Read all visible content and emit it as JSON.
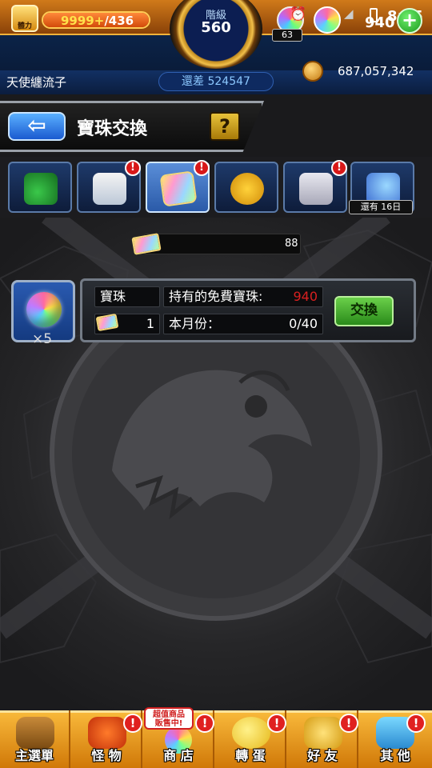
{
  "status_bar": {
    "stamina_icon_label": "體力",
    "stamina_current": "9999+",
    "stamina_max": "/436",
    "stamina_fill": 1.0,
    "rank_label": "階級",
    "rank_value": "560",
    "gem_badge": "63",
    "orb_count": "940",
    "time": "8:25",
    "plus_label": "+"
  },
  "player": {
    "name": "天使纏流子",
    "exp_remaining": "還差 524547",
    "coins": "687,057,342"
  },
  "header": {
    "back_label": "⇦",
    "title": "寶珠交換",
    "help_label": "?"
  },
  "tabs": [
    {
      "name": "lucky-clover",
      "badge": ""
    },
    {
      "name": "gift-items",
      "badge": "!"
    },
    {
      "name": "orb-ticket",
      "badge": "!"
    },
    {
      "name": "monster-gift",
      "badge": ""
    },
    {
      "name": "shop-building",
      "badge": "!"
    },
    {
      "name": "orb-exchange-event",
      "badge": "",
      "days_left": "還有 16日"
    }
  ],
  "ticket": {
    "count": "88"
  },
  "exchange": {
    "orb_multiplier": "×5",
    "orb_label": "寶珠",
    "owned_label": "持有的免費寶珠:",
    "owned_value": "940",
    "ticket_cost": "1",
    "month_label": "本月份：",
    "month_value": "0/40",
    "button_label": "交換"
  },
  "bottom_nav": {
    "items": [
      {
        "label": "主選單",
        "badge": ""
      },
      {
        "label": "怪 物",
        "badge": "!"
      },
      {
        "label": "商 店",
        "badge": "!",
        "sale_tag_line1": "超值商品",
        "sale_tag_line2": "販售中!"
      },
      {
        "label": "轉 蛋",
        "badge": "!"
      },
      {
        "label": "好 友",
        "badge": "!"
      },
      {
        "label": "其 他",
        "badge": "!"
      }
    ]
  },
  "colors": {
    "accent_orange": "#e08818",
    "panel_border": "#737b86",
    "exchange_green": "#2a8a1a",
    "owned_red": "#d82020",
    "exp_blue": "#8cc8ff"
  }
}
